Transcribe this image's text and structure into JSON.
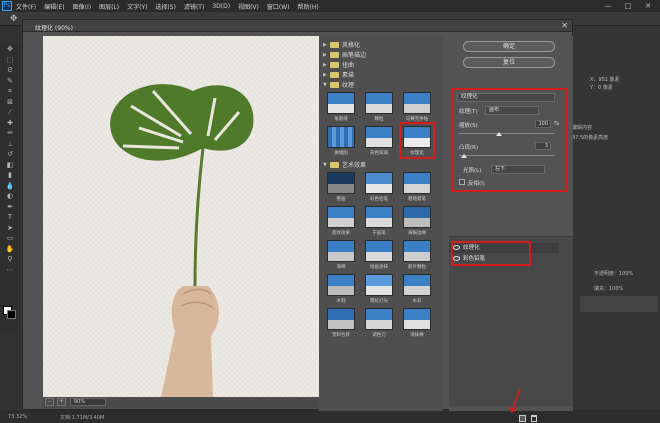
{
  "menubar": {
    "items": [
      "文件(F)",
      "编辑(E)",
      "图像(I)",
      "图层(L)",
      "文字(Y)",
      "选择(S)",
      "滤镜(T)",
      "3D(D)",
      "视图(V)",
      "窗口(W)",
      "帮助(H)"
    ],
    "ps_logo": "Ps"
  },
  "dialog": {
    "title": "纹理化 (90%)",
    "ok_label": "确定",
    "reset_label": "复位",
    "filter_name": "纹理化",
    "zoom_value": "90%",
    "params": {
      "texture_label": "纹理(T)",
      "texture_value": "画布",
      "scale_label": "缩放(S)",
      "scale_value": "100",
      "scale_unit": "%",
      "relief_label": "凸现(R)",
      "relief_value": "3",
      "light_label": "光照(L)",
      "light_value": "左下",
      "invert_label": "反相(I)"
    },
    "effect_layers": [
      "纹理化",
      "彩色铅笔"
    ]
  },
  "gallery": {
    "folders_top": [
      "风格化",
      "画笔描边",
      "扭曲",
      "素描"
    ],
    "texture_folder": "纹理",
    "texture_items": [
      "龟裂缝",
      "颗粒",
      "马赛克拼贴",
      "拼缀图",
      "染色玻璃",
      "纹理化"
    ],
    "art_folder": "艺术效果",
    "art_items": [
      "壁画",
      "彩色铅笔",
      "粗糙蜡笔",
      "底纹效果",
      "干画笔",
      "海报边缘",
      "海绵",
      "绘画涂抹",
      "胶片颗粒",
      "木刻",
      "霓虹灯光",
      "水彩",
      "塑料包装",
      "调色刀",
      "涂抹棒"
    ]
  },
  "rightpanel": {
    "info_a": "X：951 像素",
    "info_b": "Y：0 像素",
    "text_a": "编辑内容",
    "text_b": "87.5的像素高度",
    "opacity": "不透明度：100%",
    "fill": "填充：100%"
  },
  "statusbar": {
    "zoom": "73.32%",
    "doc": "文档:1.71M/3.40M"
  },
  "colors": {
    "highlight": "#d41e1e",
    "app_bg": "#323232",
    "dialog_bg": "#535353"
  }
}
